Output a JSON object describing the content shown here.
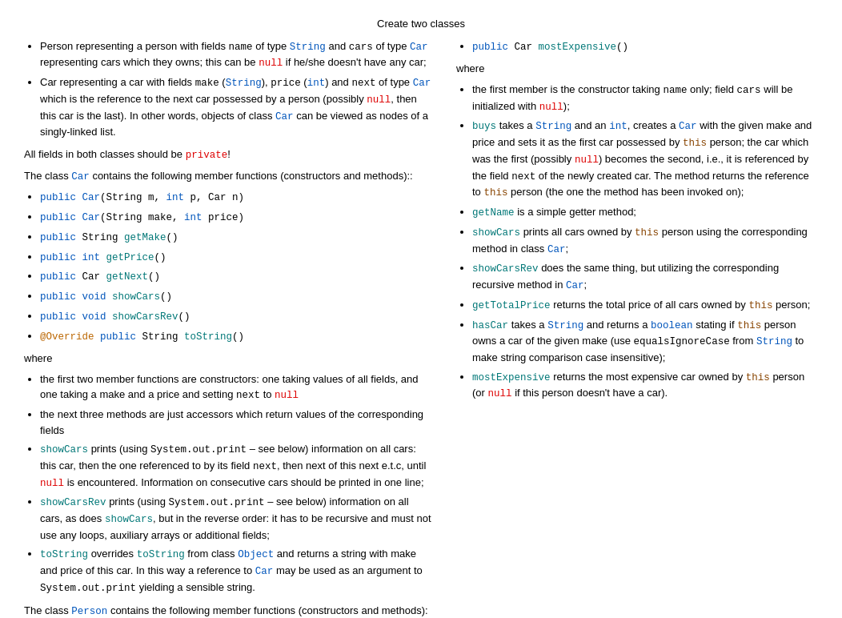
{
  "title": "Create two classes",
  "content": "static content rendered inline"
}
